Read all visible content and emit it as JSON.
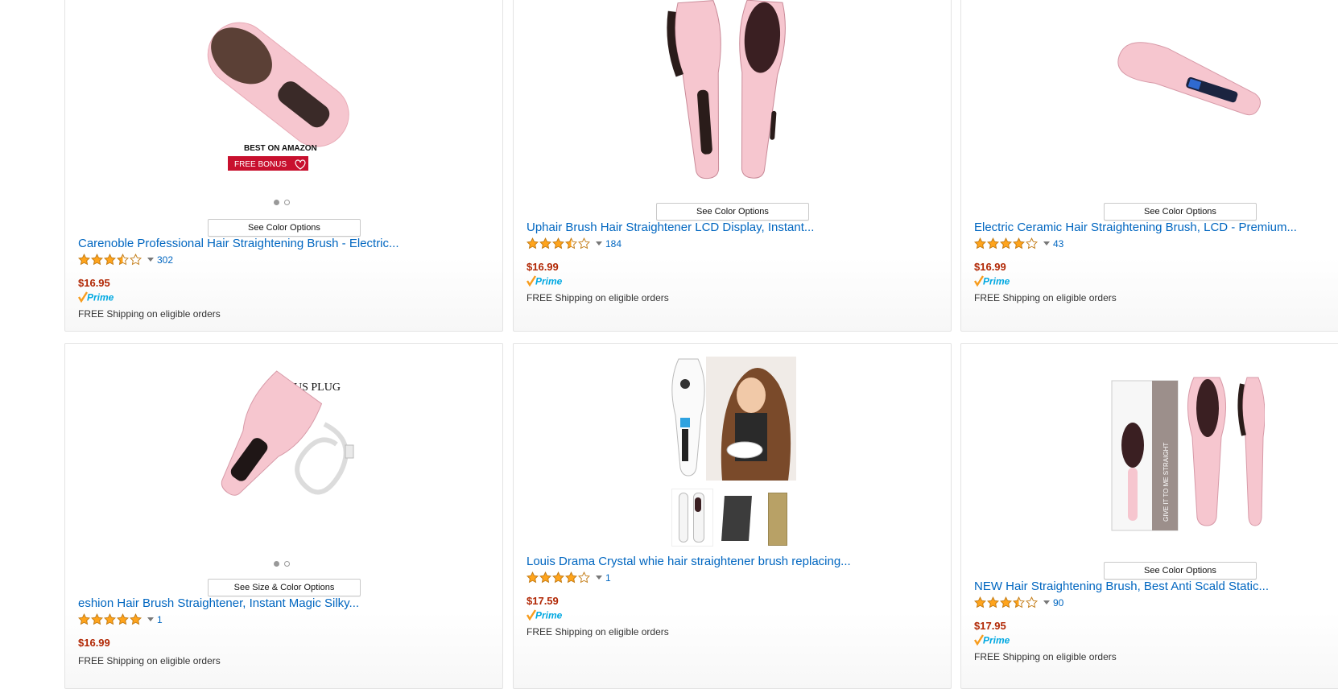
{
  "products": [
    {
      "title": "Carenoble Professional Hair Straightening Brush - Electric...",
      "rating": 3.5,
      "reviews": "302",
      "price": "$16.95",
      "prime": true,
      "shipping": "FREE Shipping on eligible orders",
      "option_label": "See Color Options",
      "badge_top": "BEST ON AMAZON",
      "badge_bottom": "FREE BONUS",
      "carousel_dots": 2
    },
    {
      "title": "Uphair Brush Hair Straightener LCD Display, Instant...",
      "rating": 3.5,
      "reviews": "184",
      "price": "$16.99",
      "prime": true,
      "shipping": "FREE Shipping on eligible orders",
      "option_label": "See Color Options"
    },
    {
      "title": "Electric Ceramic Hair Straightening Brush, LCD - Premium...",
      "rating": 4,
      "reviews": "43",
      "price": "$16.99",
      "prime": true,
      "shipping": "FREE Shipping on eligible orders",
      "option_label": "See Color Options"
    },
    {
      "title": "eshion Hair Brush Straightener, Instant Magic Silky...",
      "rating": 5,
      "reviews": "1",
      "price": "$16.99",
      "prime": false,
      "shipping": "FREE Shipping on eligible orders",
      "option_label": "See Size & Color Options",
      "image_caption": "US PLUG",
      "carousel_dots": 2
    },
    {
      "title": "Louis Drama Crystal whie hair straightener brush replacing...",
      "rating": 4,
      "reviews": "1",
      "price": "$17.59",
      "prime": true,
      "shipping": "FREE Shipping on eligible orders"
    },
    {
      "title": "NEW Hair Straightening Brush, Best Anti Scald Static...",
      "rating": 3.5,
      "reviews": "90",
      "price": "$17.95",
      "prime": true,
      "shipping": "FREE Shipping on eligible orders",
      "option_label": "See Color Options",
      "box_text": "GIVE IT TO ME STRAIGHT"
    }
  ],
  "prime_label": "Prime",
  "colors": {
    "link": "#0066c0",
    "price": "#b12704",
    "star": "#ffa41c",
    "brush_pink": "#f6c6cf",
    "prime_blue": "#00a8e1",
    "prime_orange": "#f79c1d"
  }
}
